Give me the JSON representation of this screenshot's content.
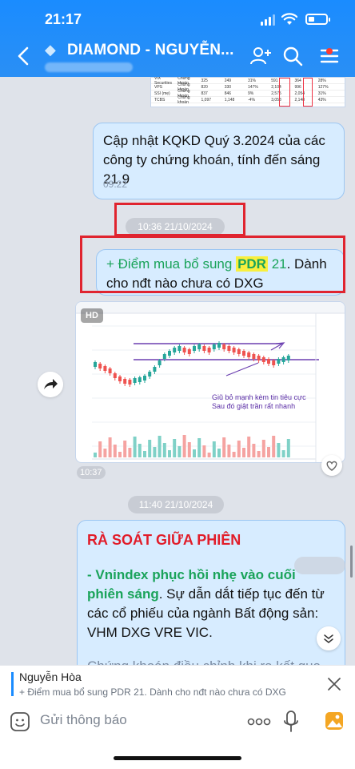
{
  "status_bar": {
    "time": "21:17"
  },
  "header": {
    "title": "DIAMOND - NGUYỄN..."
  },
  "top_table": {
    "rows": [
      [
        "VIX Securities",
        "Chứng khoán",
        "325",
        "249",
        "31%",
        "591",
        "364",
        "28%"
      ],
      [
        "VPS",
        "Chứng khoán",
        "820",
        "330",
        "147%",
        "2,104",
        "996",
        "127%"
      ],
      [
        "SSI (mẹ)",
        "Chứng khoán",
        "837",
        "846",
        "9%",
        "2,575",
        "2,054",
        "31%"
      ],
      [
        "TCBS",
        "Chứng khoán",
        "1,097",
        "1,148",
        "-4%",
        "3,058",
        "2,148",
        "43%"
      ]
    ]
  },
  "messages": {
    "m1": {
      "text": "Cập nhật KQKD Quý 3.2024 của các công ty chứng khoán, tính đến sáng 21.9",
      "time": "09:22"
    },
    "date1": "10:36 21/10/2024",
    "m2": {
      "prefix": "+ Điểm mua bổ sung ",
      "ticker": "PDR",
      "price": " 21",
      "rest": ". Dành cho nđt nào chưa có DXG"
    },
    "m3": {
      "hd": "HD",
      "note_line1": "Giũ bỏ mạnh kèm tin tiêu cực",
      "note_line2": "Sau đó giật trần rất nhanh",
      "time": "10:37"
    },
    "date2": "11:40 21/10/2024",
    "m4": {
      "heading": "RÀ SOÁT GIỮA PHIÊN",
      "p1_green": "- Vnindex phục hồi nhẹ vào cuối phiên sáng",
      "p1_rest": ". Sự dẫn dắt tiếp tục đến từ các cổ phiếu của ngành Bất động sản: VHM DXG VRE VIC.",
      "p2": "Chứng khoán điều chỉnh khi ra kết qua kinh doanh không thực sự ấn tượng"
    }
  },
  "reply": {
    "name": "Nguyễn Hòa",
    "text": "+ Điểm mua bổ sung PDR 21. Dành cho nđt nào chưa có DXG"
  },
  "composer": {
    "placeholder": "Gửi thông báo"
  },
  "colors": {
    "accent": "#1a8cff",
    "bubble": "#d7ecff",
    "highlight_box": "#e0242f",
    "green": "#1aa35a",
    "red": "#e11d2a"
  },
  "icons": [
    "back-arrow-icon",
    "diamond-icon",
    "add-member-icon",
    "search-icon",
    "menu-icon",
    "share-icon",
    "heart-icon",
    "scroll-down-icon",
    "close-icon",
    "emoji-icon",
    "more-icon",
    "mic-icon",
    "image-icon"
  ]
}
